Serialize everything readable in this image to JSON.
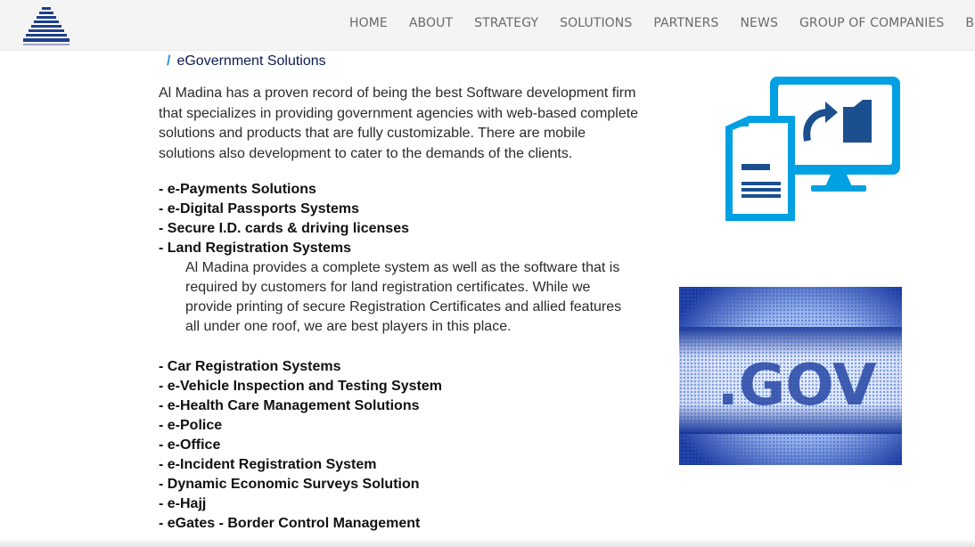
{
  "nav": {
    "items": [
      {
        "label": "HOME"
      },
      {
        "label": "ABOUT"
      },
      {
        "label": "STRATEGY"
      },
      {
        "label": "SOLUTIONS"
      },
      {
        "label": "PARTNERS"
      },
      {
        "label": "NEWS"
      },
      {
        "label": "GROUP OF COMPANIES"
      },
      {
        "label": "BRA"
      }
    ]
  },
  "breadcrumb": {
    "separator": "/",
    "current": "eGovernment Solutions"
  },
  "intro": "Al Madina has a proven record of being the best Software development firm that specializes in providing government agencies with web-based complete solutions and products that are fully customizable. There are mobile solutions also development to cater to the demands of the clients.",
  "solutions_part1": [
    "- e-Payments Solutions",
    "- e-Digital Passports Systems",
    "- Secure I.D. cards & driving licenses",
    "- Land Registration Systems"
  ],
  "land_registration_description": "Al Madina provides a complete system as well as the software that is required by customers for land registration certificates. While we provide printing of secure Registration Certificates and allied features all under one roof, we are best players in this place.",
  "solutions_part2": [
    "- Car Registration Systems",
    "- e-Vehicle Inspection and Testing System",
    "- e-Health Care Management Solutions",
    "- e-Police",
    "- e-Office",
    "- e-Incident Registration System",
    "- Dynamic Economic Surveys Solution",
    "- e-Hajj",
    "- eGates - Border Control Management"
  ],
  "gov_image_text": ".GOV",
  "colors": {
    "accent_blue": "#00a0e3",
    "dark_blue": "#1b4f8f",
    "nav_text": "#6a6a6a",
    "breadcrumb_text": "#0c1c52"
  }
}
